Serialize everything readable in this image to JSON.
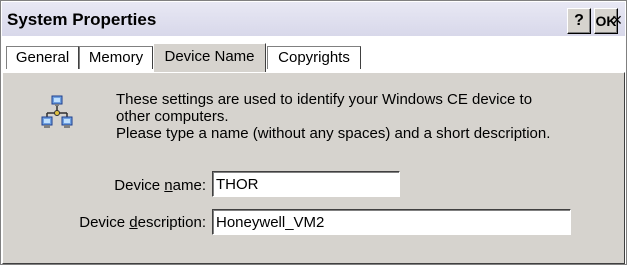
{
  "window": {
    "title": "System Properties"
  },
  "titlebar_buttons": {
    "help": "?",
    "ok": "OK",
    "close": "×"
  },
  "tabs": [
    {
      "label": "General"
    },
    {
      "label": "Memory"
    },
    {
      "label": "Device Name",
      "active": true
    },
    {
      "label": "Copyrights"
    }
  ],
  "device_name_tab": {
    "description_line1": "These settings are used to identify your Windows CE device to",
    "description_line2": "other computers.",
    "description_line3": "Please type a name (without any spaces) and a short description.",
    "device_name_label_prefix": "Device ",
    "device_name_label_access": "n",
    "device_name_label_suffix": "ame:",
    "device_name_value": "THOR",
    "device_description_label_prefix": "Device ",
    "device_description_label_access": "d",
    "device_description_label_suffix": "escription:",
    "device_description_value": "Honeywell_VM2"
  },
  "colors": {
    "panel_bg": "#d6d3ce",
    "titlebar_bg": "#e0e0f0"
  },
  "icons": {
    "network_icon": "network-computers-icon"
  }
}
